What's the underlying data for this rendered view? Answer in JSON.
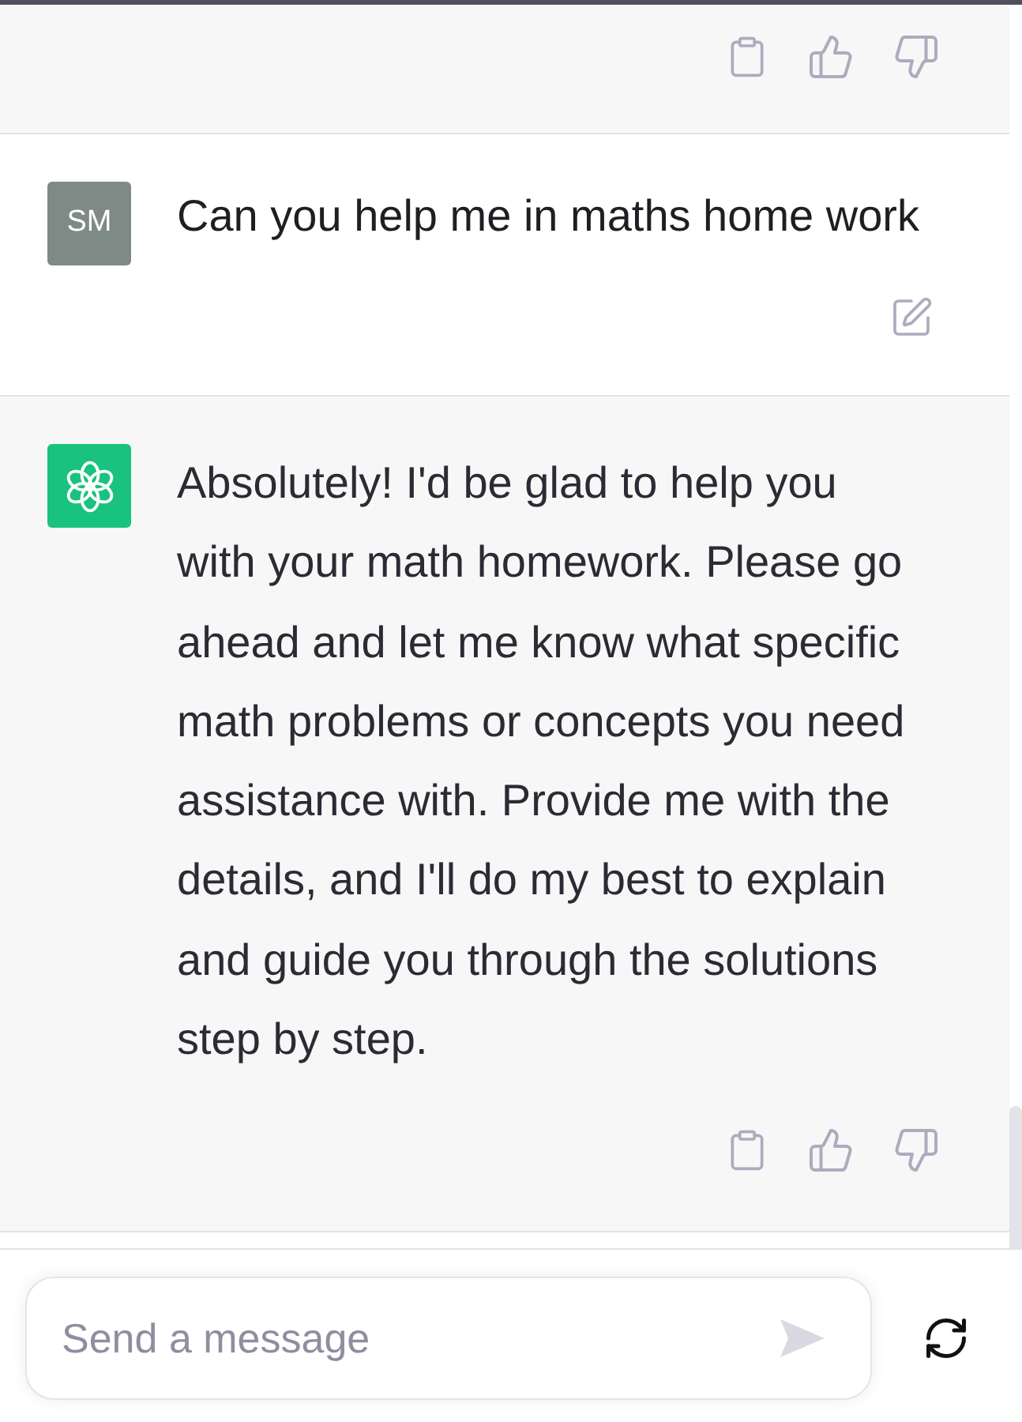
{
  "conversation": [
    {
      "kind": "assistant_tail"
    },
    {
      "kind": "user",
      "avatar": "SM",
      "text": "Can you help me in maths home work"
    },
    {
      "kind": "assistant",
      "text": "Absolutely! I'd be glad to help you with your math homework. Please go ahead and let me know what specific math problems or concepts you need assistance with. Provide me with the details, and I'll do my best to explain and guide you through the solutions step by step."
    }
  ],
  "composer": {
    "placeholder": "Send a message"
  }
}
